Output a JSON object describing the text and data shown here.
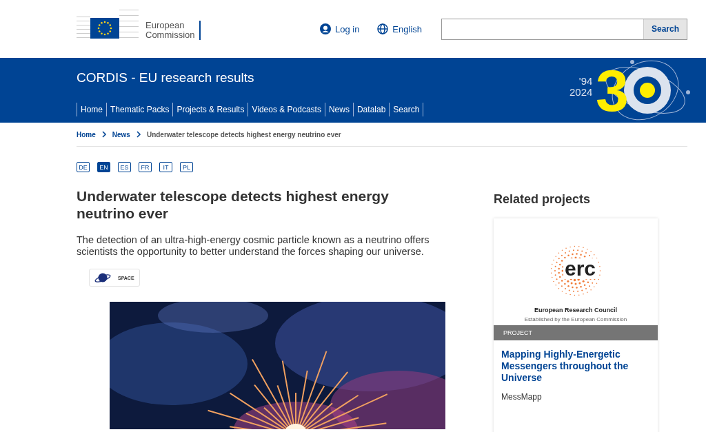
{
  "header": {
    "logo_text": [
      "European",
      "Commission"
    ],
    "login": "Log in",
    "language": "English",
    "search": {
      "button": "Search"
    }
  },
  "banner": {
    "title": "CORDIS - EU research results",
    "nav": [
      "Home",
      "Thematic Packs",
      "Projects & Results",
      "Videos & Podcasts",
      "News",
      "Datalab",
      "Search"
    ],
    "anniversary": {
      "years": [
        "'94",
        "2024"
      ],
      "number": "3"
    }
  },
  "breadcrumb": [
    "Home",
    "News",
    "Underwater telescope detects highest energy neutrino ever"
  ],
  "languages": [
    {
      "code": "DE",
      "selected": false
    },
    {
      "code": "EN",
      "selected": true
    },
    {
      "code": "ES",
      "selected": false
    },
    {
      "code": "FR",
      "selected": false
    },
    {
      "code": "IT",
      "selected": false
    },
    {
      "code": "PL",
      "selected": false
    }
  ],
  "article": {
    "title": "Underwater telescope detects highest energy neutrino ever",
    "summary": "The detection of an ultra-high-energy cosmic particle known as a neutrino offers scientists the opportunity to better understand the forces shaping our universe.",
    "tag": "SPACE"
  },
  "related": {
    "heading": "Related projects",
    "card": {
      "logo": {
        "mark": "erc",
        "name": "European Research Council",
        "subtitle": "Established by the European Commission"
      },
      "type": "PROJECT",
      "title": "Mapping Highly-Energetic Messengers throughout the Universe",
      "acronym": "MessMapp"
    }
  }
}
